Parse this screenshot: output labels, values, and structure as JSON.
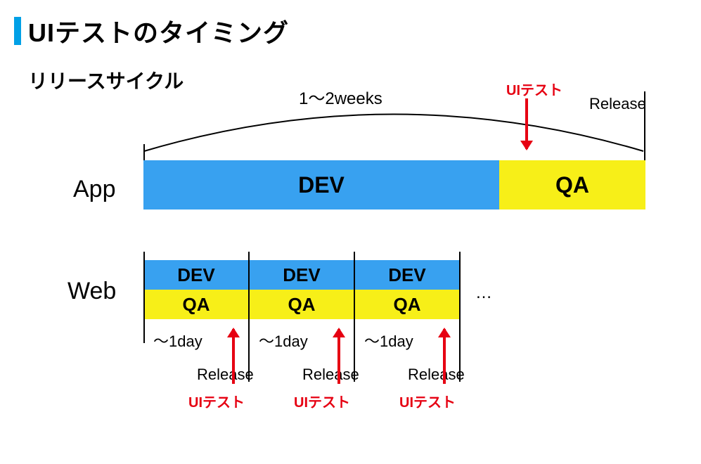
{
  "title": "UIテストのタイミング",
  "subtitle": "リリースサイクル",
  "duration_label_app": "1～2weeks",
  "release_label": "Release",
  "ui_test_label": "UIテスト",
  "row_labels": {
    "app": "App",
    "web": "Web"
  },
  "phases": {
    "dev": "DEV",
    "qa": "QA"
  },
  "web_day_label": "～1day",
  "ellipsis": "…",
  "colors": {
    "accent": "#00a0e6",
    "dev": "#38a1f0",
    "qa": "#f7ef18",
    "red": "#e60012"
  }
}
